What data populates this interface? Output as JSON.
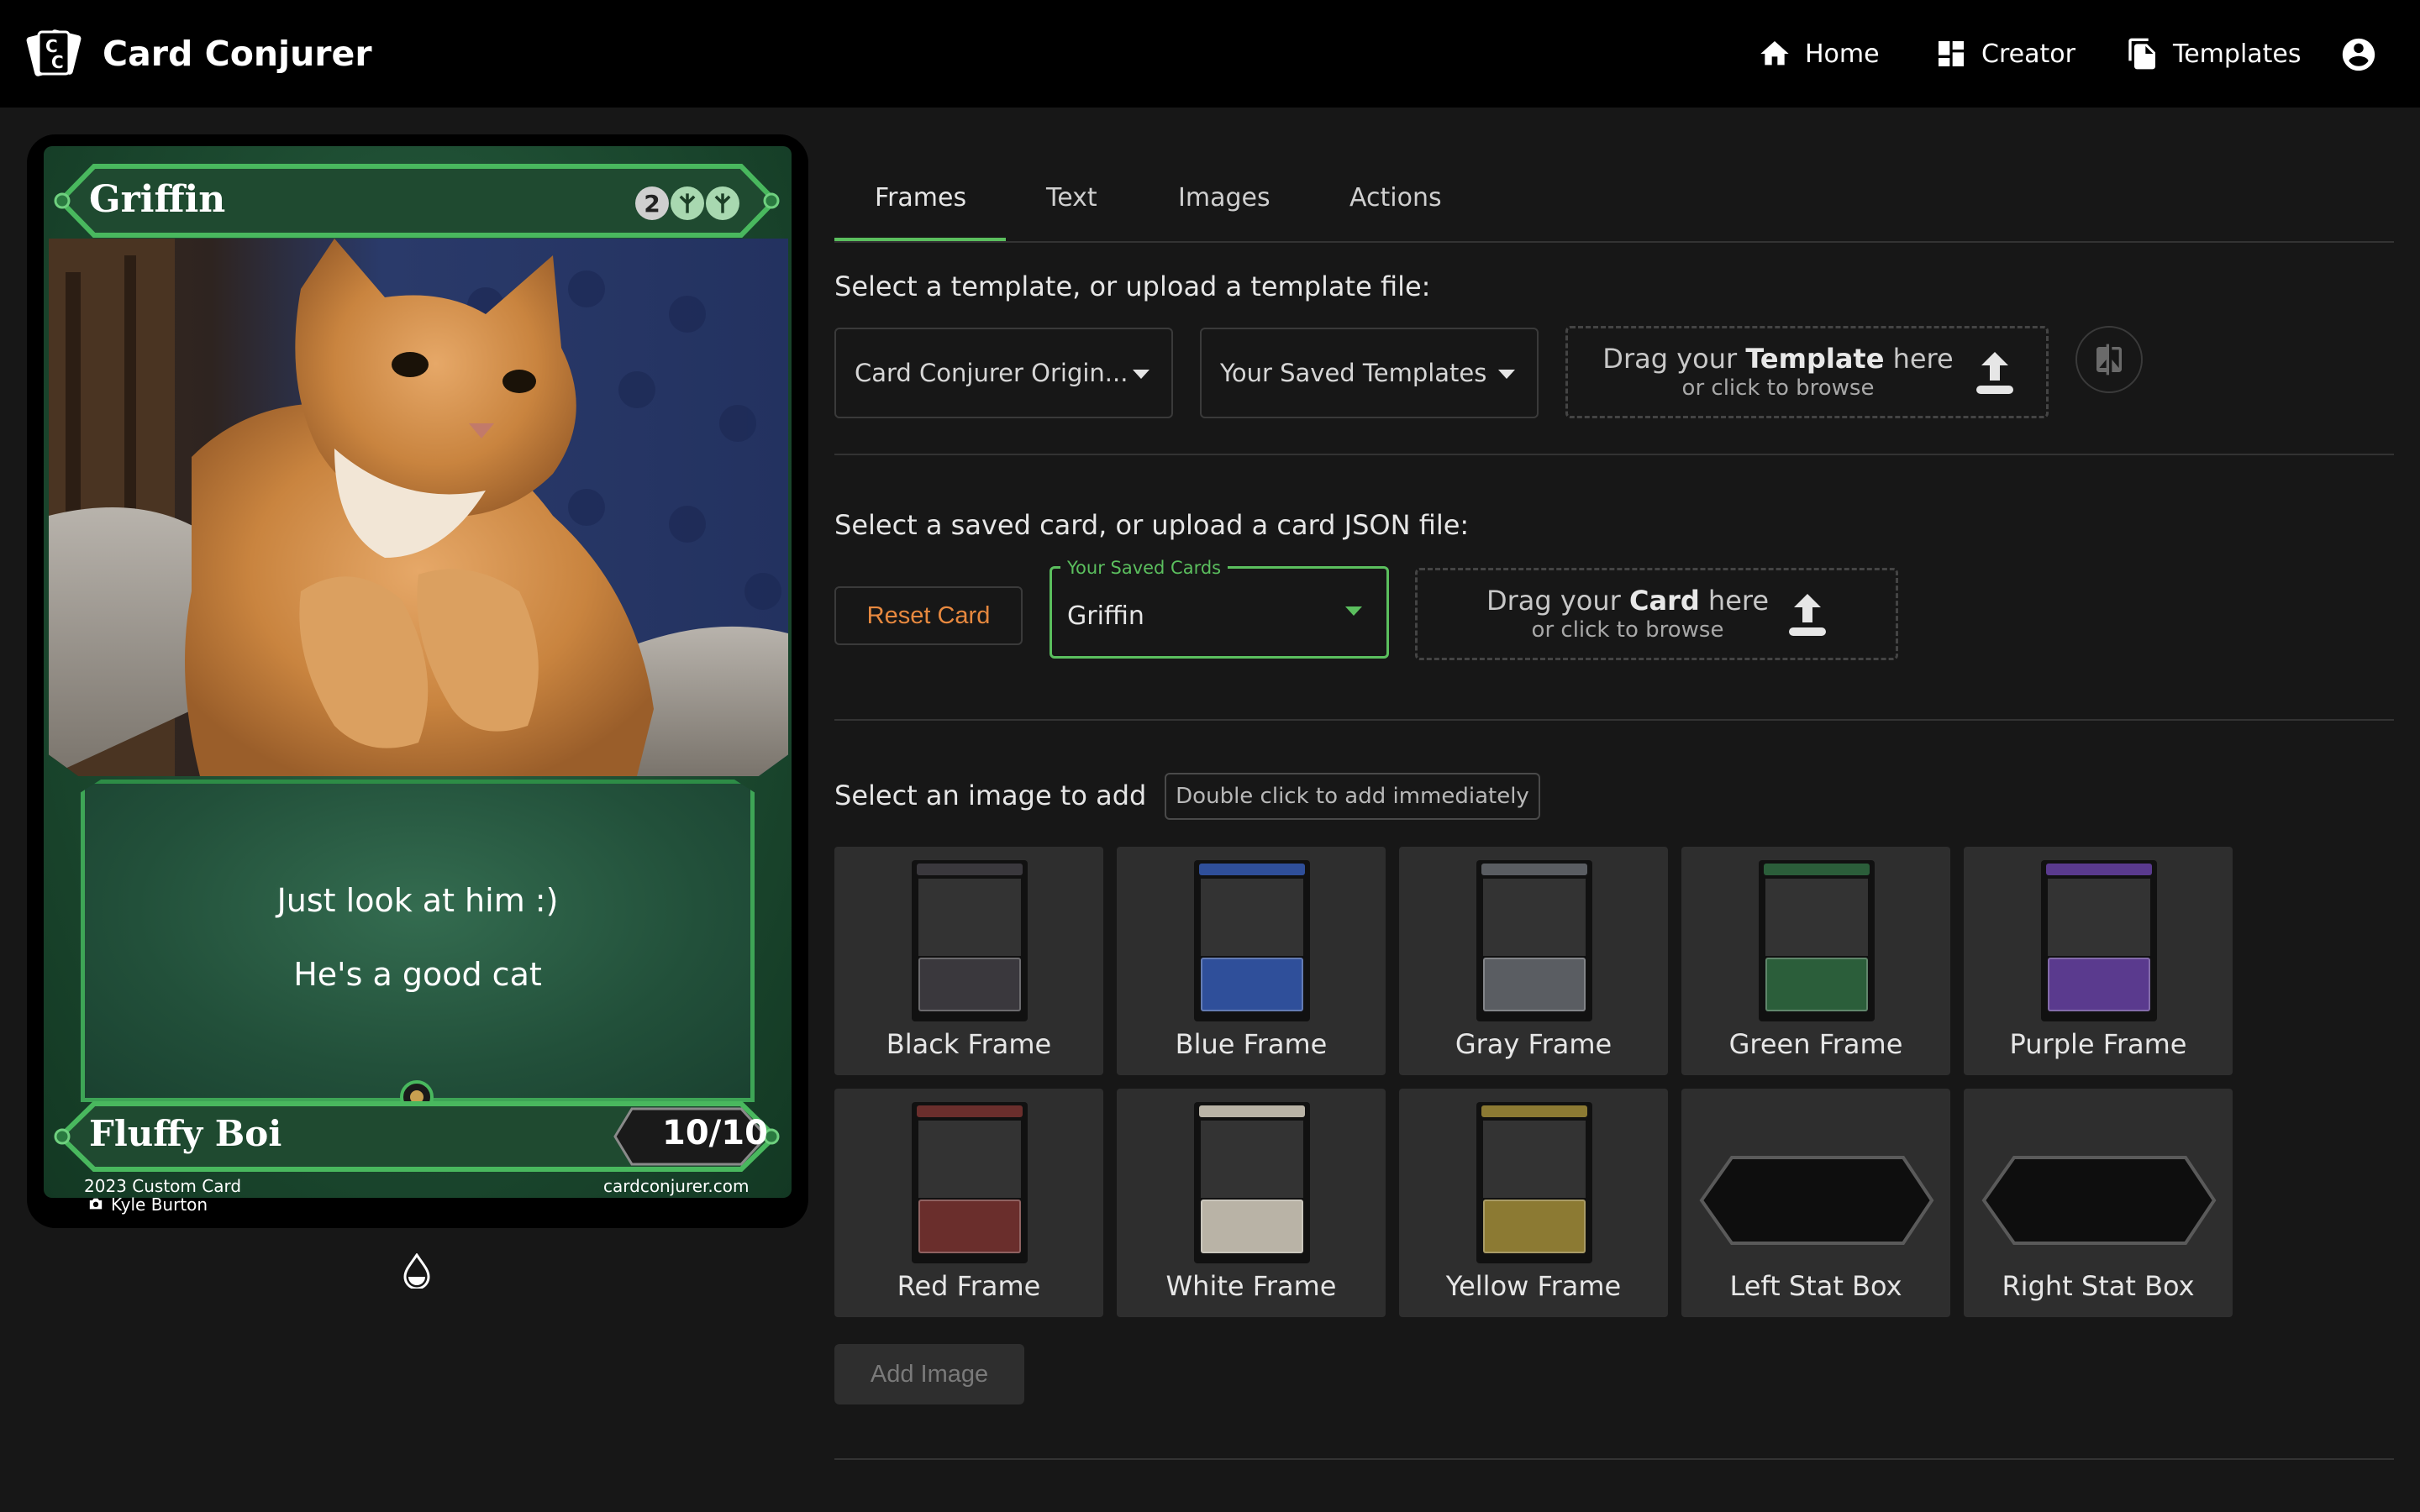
{
  "app": {
    "title": "Card Conjurer",
    "nav": [
      {
        "label": "Home",
        "icon": "home-icon"
      },
      {
        "label": "Creator",
        "icon": "dashboard-icon"
      },
      {
        "label": "Templates",
        "icon": "documents-icon"
      }
    ],
    "account_icon": "account-circle-icon"
  },
  "card": {
    "name": "Griffin",
    "mana": [
      "2",
      "G",
      "G"
    ],
    "rules": [
      "Just look at him :)",
      "He's a good cat"
    ],
    "type_line": "Fluffy Boi",
    "pt": "10/10",
    "footer_left_1": "2023 Custom Card",
    "footer_left_2": "Kyle Burton",
    "footer_right": "cardconjurer.com",
    "accent": "#3ea556"
  },
  "tabs": [
    {
      "label": "Frames",
      "active": true
    },
    {
      "label": "Text",
      "active": false
    },
    {
      "label": "Images",
      "active": false
    },
    {
      "label": "Actions",
      "active": false
    }
  ],
  "template_section": {
    "label": "Select a template, or upload a template file:",
    "template_select": "Card Conjurer Origin...",
    "saved_templates_select": "Your Saved Templates",
    "dropzone_pre": "Drag your ",
    "dropzone_bold": "Template",
    "dropzone_post": " here",
    "dropzone_sub": "or click to browse"
  },
  "card_section": {
    "label": "Select a saved card, or upload a card JSON file:",
    "reset_label": "Reset Card",
    "saved_cards_legend": "Your Saved Cards",
    "saved_cards_value": "Griffin",
    "dropzone_pre": "Drag your ",
    "dropzone_bold": "Card",
    "dropzone_post": " here",
    "dropzone_sub": "or click to browse"
  },
  "image_section": {
    "label": "Select an image to add",
    "hint": "Double click to add immediately",
    "add_label": "Add Image",
    "tiles": [
      {
        "label": "Black Frame",
        "color": "#3a383d"
      },
      {
        "label": "Blue Frame",
        "color": "#2f4f9a"
      },
      {
        "label": "Gray Frame",
        "color": "#5a5d62"
      },
      {
        "label": "Green Frame",
        "color": "#2b5e3a"
      },
      {
        "label": "Purple Frame",
        "color": "#5a3a8e"
      },
      {
        "label": "Red Frame",
        "color": "#6a2e2c"
      },
      {
        "label": "White Frame",
        "color": "#b9b3a6"
      },
      {
        "label": "Yellow Frame",
        "color": "#8c7a33"
      },
      {
        "label": "Left Stat Box",
        "color": "#1e1e1e"
      },
      {
        "label": "Right Stat Box",
        "color": "#1e1e1e"
      }
    ]
  },
  "colors": {
    "accent_green": "#5bbf5e",
    "reset_orange": "#e8893f"
  }
}
